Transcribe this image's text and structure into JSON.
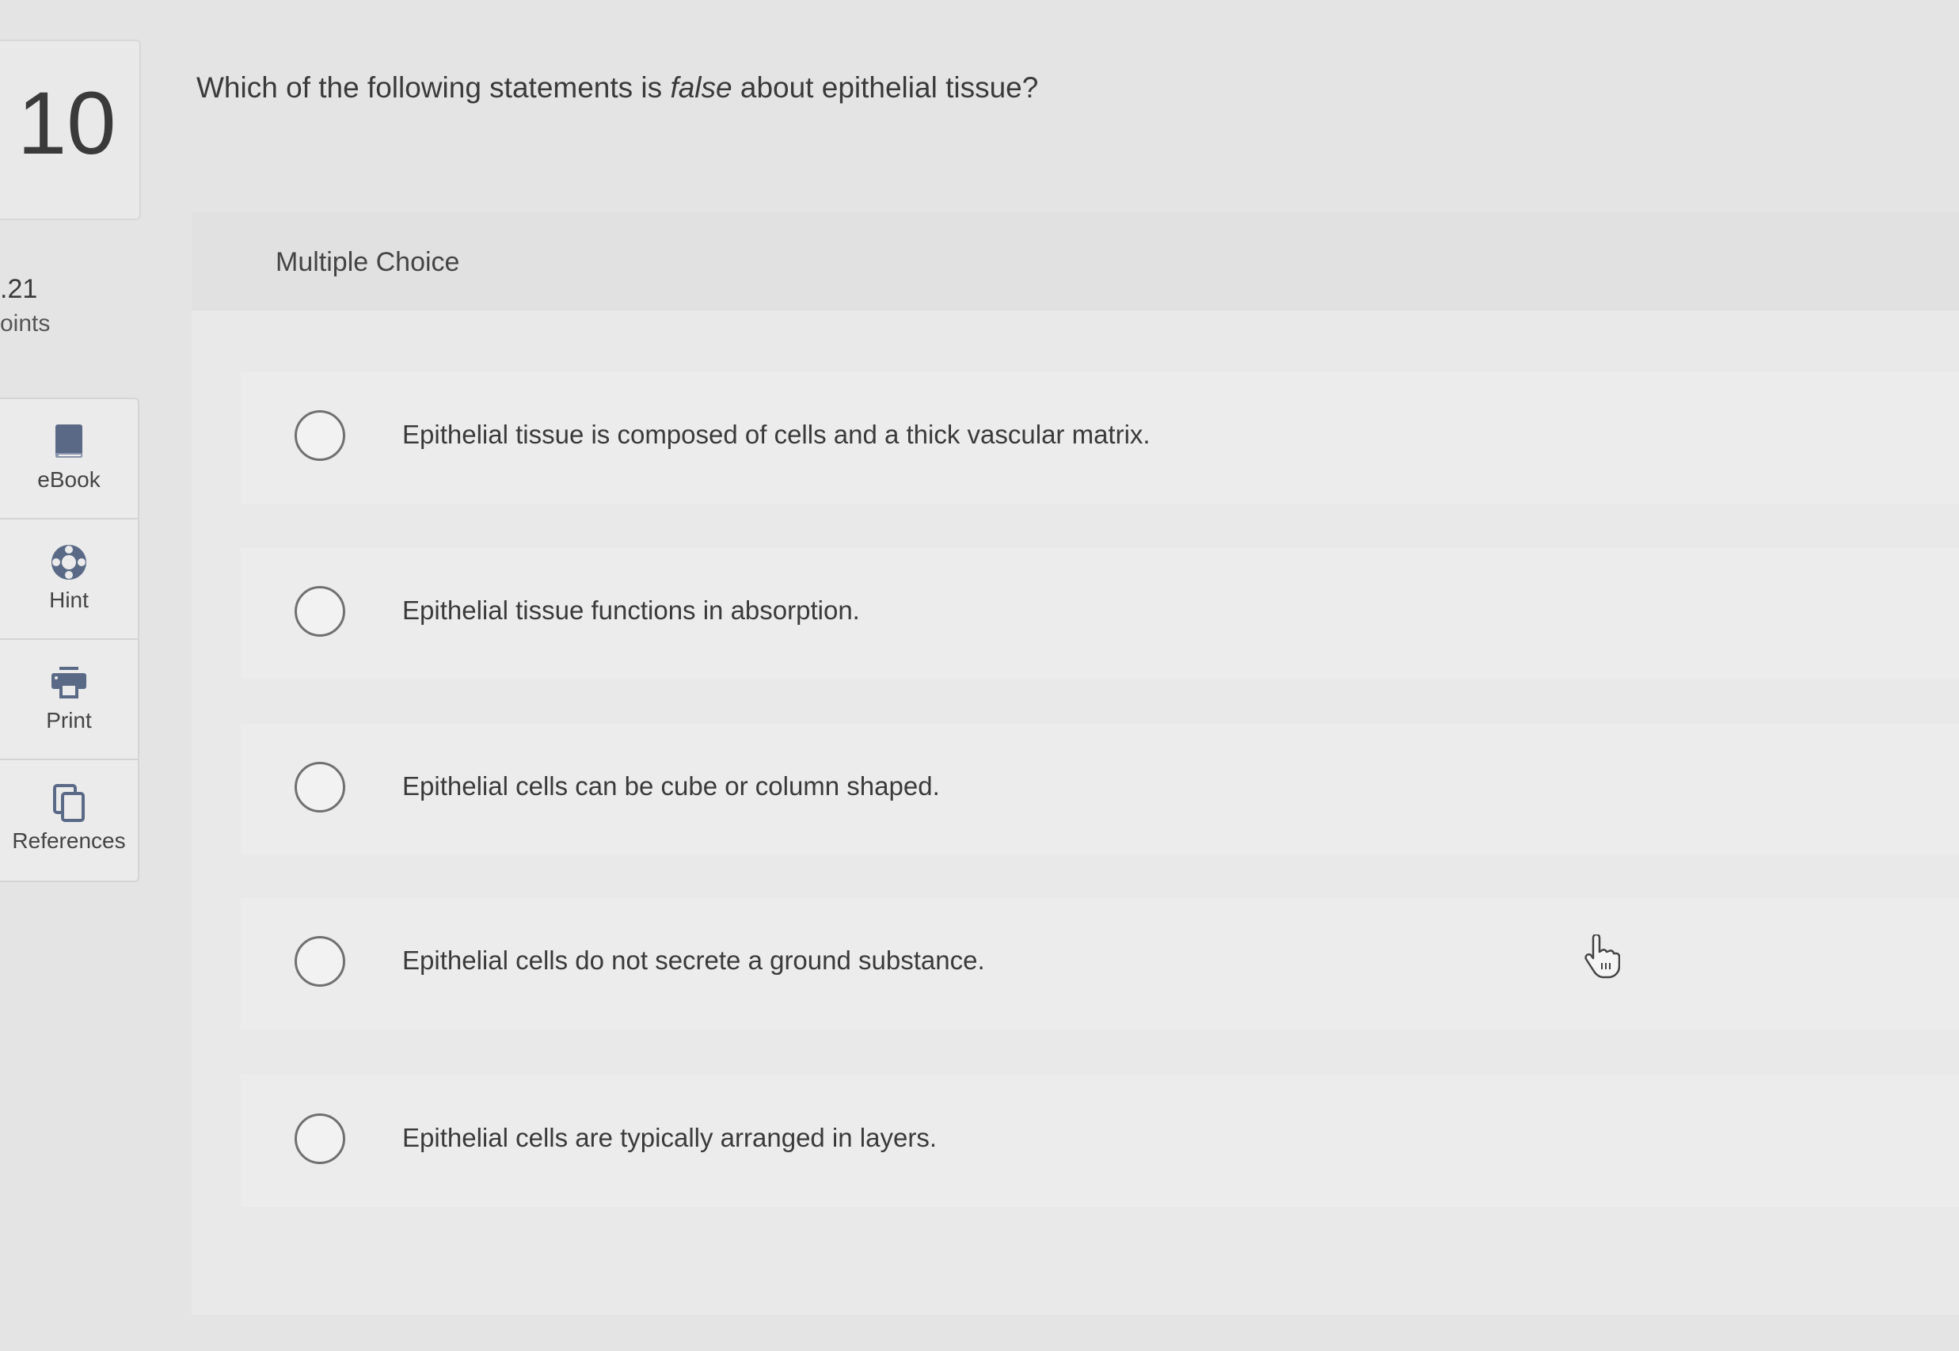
{
  "question": {
    "number": "10",
    "points_value": ".21",
    "points_label": "oints",
    "prompt_before": "Which of the following statements is ",
    "prompt_emphasis": "false",
    "prompt_after": " about epithelial tissue?"
  },
  "tools": [
    {
      "label": "eBook",
      "icon": "book-icon"
    },
    {
      "label": "Hint",
      "icon": "lifebuoy-icon"
    },
    {
      "label": "Print",
      "icon": "printer-icon"
    },
    {
      "label": "References",
      "icon": "copy-icon"
    }
  ],
  "answer_panel": {
    "type_label": "Multiple Choice",
    "options": [
      {
        "text": "Epithelial tissue is composed of cells and a thick vascular matrix.",
        "selected": false
      },
      {
        "text": "Epithelial tissue functions in absorption.",
        "selected": false
      },
      {
        "text": "Epithelial cells can be cube or column shaped.",
        "selected": false
      },
      {
        "text": "Epithelial cells do not secrete a ground substance.",
        "selected": false
      },
      {
        "text": "Epithelial cells are typically arranged in layers.",
        "selected": false
      }
    ]
  },
  "colors": {
    "icon": "#5a6a86",
    "background": "#e4e4e4"
  }
}
